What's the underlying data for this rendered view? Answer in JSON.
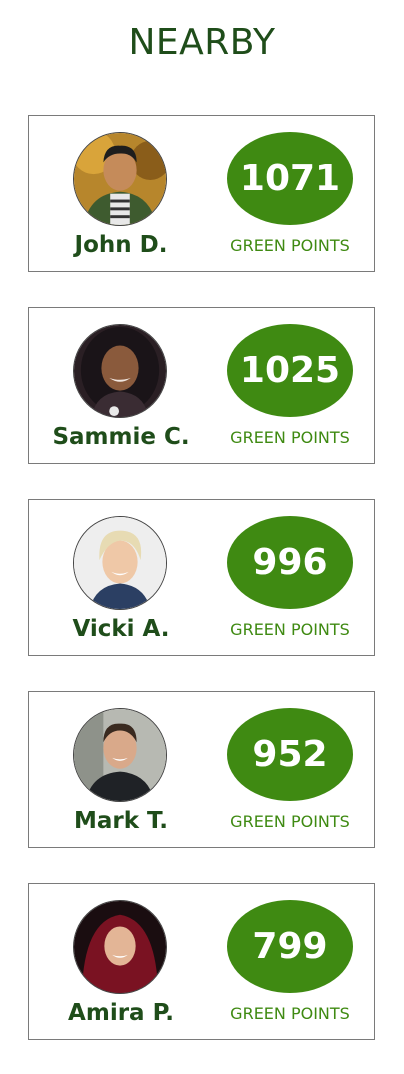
{
  "header": {
    "title": "NEARBY"
  },
  "points_label": "GREEN POINTS",
  "colors": {
    "accent": "#3f8a12",
    "text_dark": "#1f4d1a",
    "border": "#7a7a7a"
  },
  "people": [
    {
      "name": "John D.",
      "points": "1071",
      "avatar_icon": "avatar-photo"
    },
    {
      "name": "Sammie C.",
      "points": "1025",
      "avatar_icon": "avatar-photo"
    },
    {
      "name": "Vicki A.",
      "points": "996",
      "avatar_icon": "avatar-photo"
    },
    {
      "name": "Mark T.",
      "points": "952",
      "avatar_icon": "avatar-photo"
    },
    {
      "name": "Amira P.",
      "points": "799",
      "avatar_icon": "avatar-photo"
    }
  ]
}
